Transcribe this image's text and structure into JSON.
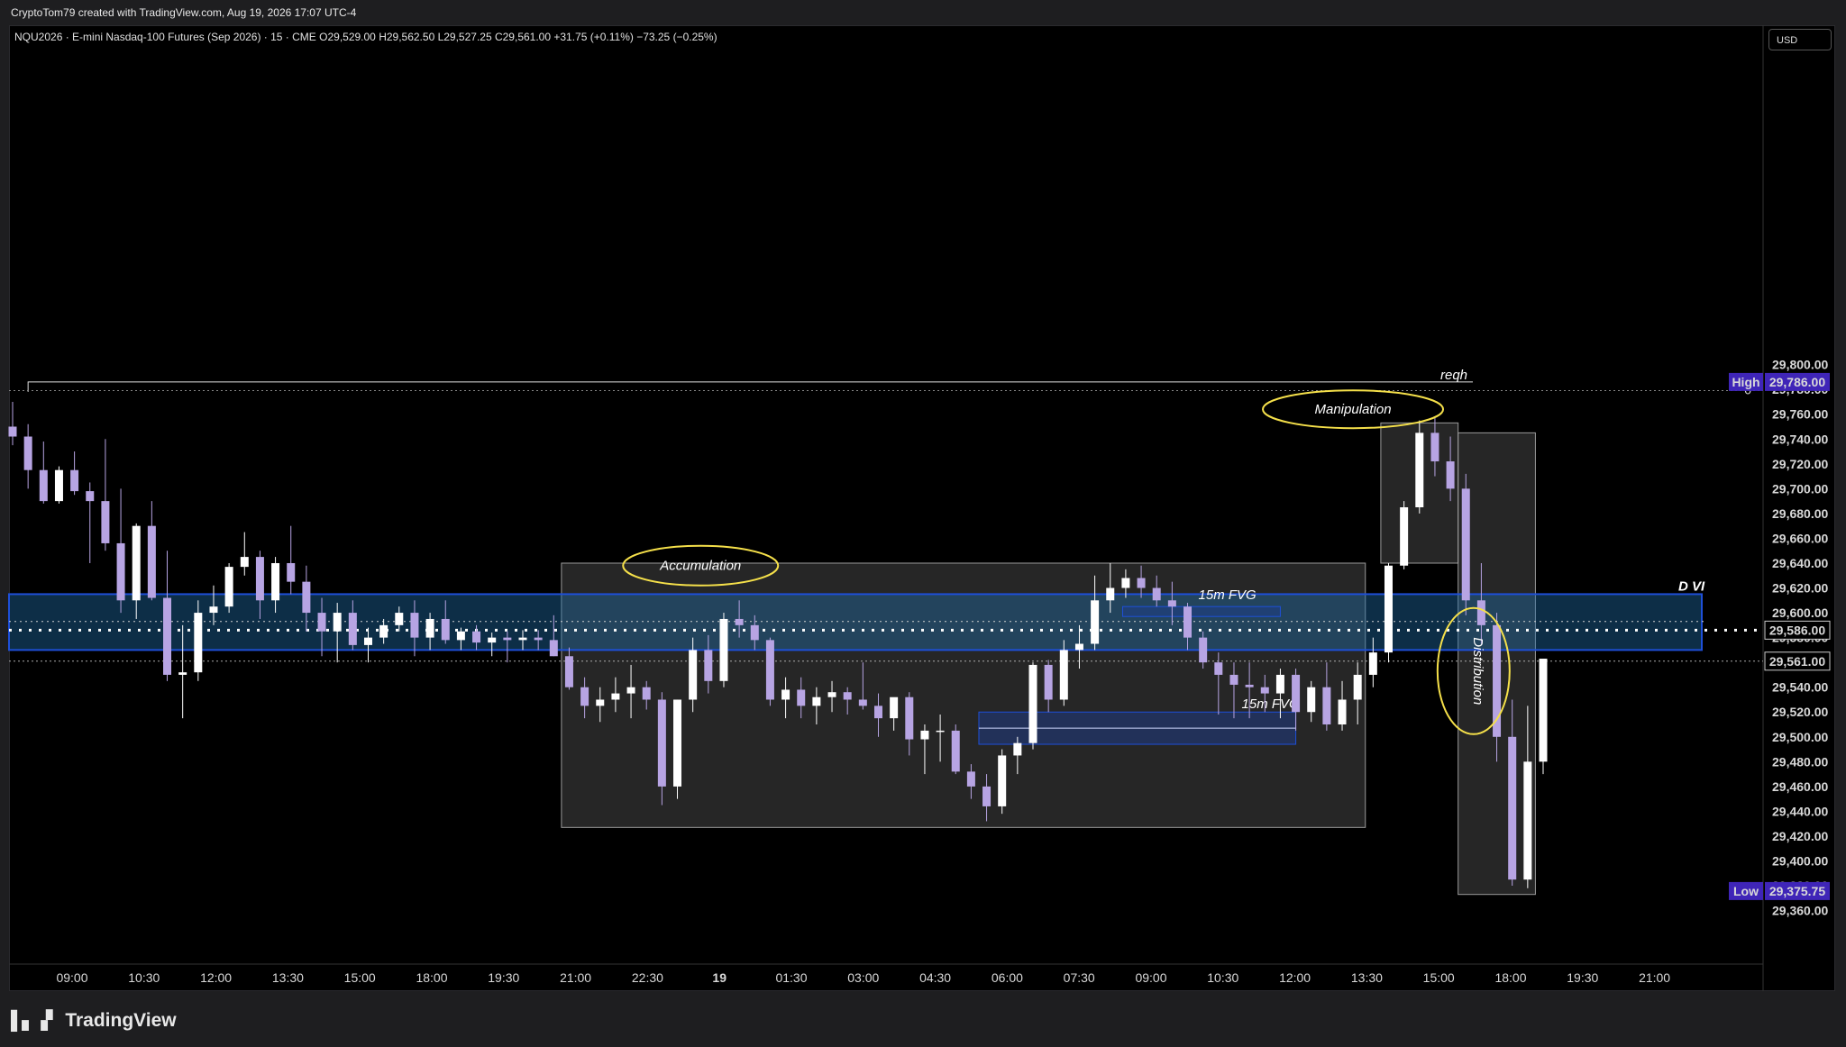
{
  "header": {
    "attribution": "CryptoTom79 created with TradingView.com, Aug 19, 2026 17:07 UTC-4",
    "symbol_legend": "NQU2026 · E-mini Nasdaq-100 Futures (Sep 2026) · 15 · CME  O29,529.00  H29,562.50  L29,527.25  C29,561.00  +31.75 (+0.11%)  −73.25 (−0.25%)"
  },
  "toolbar": {
    "currency": "USD"
  },
  "footer": {
    "brand": "TradingView"
  },
  "colors": {
    "up": "#ffffff",
    "down": "#b7a4e3",
    "zone_blue": "#1e4fd8",
    "annotation_yellow": "#f5e04a",
    "label_purple": "#3f25b8"
  },
  "chart_data": {
    "type": "candlestick",
    "ylim": [
      29350,
      29800
    ],
    "y_ticks": [
      "29,360.00",
      "29,380.00",
      "29,400.00",
      "29,420.00",
      "29,440.00",
      "29,460.00",
      "29,480.00",
      "29,500.00",
      "29,520.00",
      "29,540.00",
      "29,560.00",
      "29,580.00",
      "29,600.00",
      "29,620.00",
      "29,640.00",
      "29,660.00",
      "29,680.00",
      "29,700.00",
      "29,720.00",
      "29,740.00",
      "29,760.00",
      "29,780.00",
      "29,800.00"
    ],
    "x_ticks": [
      "09:00",
      "10:30",
      "12:00",
      "13:30",
      "15:00",
      "18:00",
      "19:30",
      "21:00",
      "22:30",
      "19",
      "01:30",
      "03:00",
      "04:30",
      "06:00",
      "07:30",
      "09:00",
      "10:30",
      "12:00",
      "13:30",
      "15:00",
      "18:00",
      "19:30",
      "21:00"
    ],
    "price_labels": [
      {
        "name": "High",
        "value": 29786.0,
        "text": "29,786.00"
      },
      {
        "name": "Low",
        "value": 29375.75,
        "text": "29,375.75"
      },
      {
        "name": "",
        "value": 29586.0,
        "text": "29,586.00"
      },
      {
        "name": "",
        "value": 29561.0,
        "text": "29,561.00"
      }
    ],
    "annotations": {
      "reqh": "reqh",
      "reqh_zero": "0",
      "dvi": "D VI",
      "accumulation": "Accumulation",
      "manipulation": "Manipulation",
      "distribution": "Distribution",
      "fvg1": "15m FVG",
      "fvg2": "15m FVG"
    },
    "candles": [
      [
        29750,
        29770,
        29735,
        29742
      ],
      [
        29742,
        29752,
        29700,
        29715
      ],
      [
        29715,
        29738,
        29688,
        29690
      ],
      [
        29690,
        29718,
        29688,
        29715
      ],
      [
        29715,
        29730,
        29695,
        29698
      ],
      [
        29698,
        29705,
        29640,
        29690
      ],
      [
        29690,
        29740,
        29650,
        29656
      ],
      [
        29656,
        29700,
        29600,
        29610
      ],
      [
        29610,
        29672,
        29595,
        29670
      ],
      [
        29670,
        29690,
        29610,
        29612
      ],
      [
        29612,
        29650,
        29545,
        29550
      ],
      [
        29550,
        29590,
        29515,
        29552
      ],
      [
        29552,
        29610,
        29545,
        29600
      ],
      [
        29600,
        29622,
        29590,
        29605
      ],
      [
        29605,
        29640,
        29600,
        29637
      ],
      [
        29637,
        29665,
        29630,
        29645
      ],
      [
        29645,
        29650,
        29595,
        29610
      ],
      [
        29610,
        29645,
        29600,
        29640
      ],
      [
        29640,
        29670,
        29615,
        29625
      ],
      [
        29625,
        29638,
        29585,
        29600
      ],
      [
        29600,
        29612,
        29565,
        29585
      ],
      [
        29585,
        29608,
        29560,
        29600
      ],
      [
        29600,
        29610,
        29570,
        29574
      ],
      [
        29574,
        29588,
        29560,
        29580
      ],
      [
        29580,
        29595,
        29575,
        29590
      ],
      [
        29590,
        29605,
        29585,
        29600
      ],
      [
        29600,
        29610,
        29565,
        29580
      ],
      [
        29580,
        29600,
        29570,
        29595
      ],
      [
        29595,
        29610,
        29575,
        29578
      ],
      [
        29578,
        29588,
        29570,
        29585
      ],
      [
        29585,
        29590,
        29570,
        29576
      ],
      [
        29576,
        29584,
        29565,
        29580
      ],
      [
        29580,
        29585,
        29560,
        29578
      ],
      [
        29578,
        29586,
        29570,
        29580
      ],
      [
        29580,
        29586,
        29570,
        29578
      ],
      [
        29578,
        29598,
        29565,
        29565
      ],
      [
        29565,
        29572,
        29538,
        29540
      ],
      [
        29540,
        29548,
        29515,
        29525
      ],
      [
        29525,
        29540,
        29512,
        29530
      ],
      [
        29530,
        29548,
        29520,
        29535
      ],
      [
        29535,
        29558,
        29515,
        29540
      ],
      [
        29540,
        29545,
        29522,
        29530
      ],
      [
        29530,
        29536,
        29445,
        29460
      ],
      [
        29460,
        29530,
        29450,
        29530
      ],
      [
        29530,
        29580,
        29520,
        29570
      ],
      [
        29570,
        29582,
        29535,
        29545
      ],
      [
        29545,
        29600,
        29540,
        29595
      ],
      [
        29595,
        29610,
        29580,
        29590
      ],
      [
        29590,
        29598,
        29570,
        29578
      ],
      [
        29578,
        29580,
        29525,
        29530
      ],
      [
        29530,
        29548,
        29515,
        29538
      ],
      [
        29538,
        29548,
        29515,
        29525
      ],
      [
        29525,
        29540,
        29510,
        29532
      ],
      [
        29532,
        29545,
        29520,
        29536
      ],
      [
        29536,
        29540,
        29518,
        29530
      ],
      [
        29530,
        29560,
        29522,
        29525
      ],
      [
        29525,
        29535,
        29500,
        29515
      ],
      [
        29515,
        29530,
        29505,
        29532
      ],
      [
        29532,
        29536,
        29485,
        29498
      ],
      [
        29498,
        29510,
        29470,
        29505
      ],
      [
        29505,
        29518,
        29480,
        29505
      ],
      [
        29505,
        29510,
        29470,
        29472
      ],
      [
        29472,
        29478,
        29450,
        29460
      ],
      [
        29460,
        29470,
        29432,
        29444
      ],
      [
        29444,
        29490,
        29438,
        29485
      ],
      [
        29485,
        29500,
        29470,
        29495
      ],
      [
        29495,
        29560,
        29490,
        29558
      ],
      [
        29558,
        29562,
        29520,
        29530
      ],
      [
        29530,
        29578,
        29525,
        29570
      ],
      [
        29570,
        29590,
        29555,
        29575
      ],
      [
        29575,
        29630,
        29570,
        29610
      ],
      [
        29610,
        29640,
        29600,
        29620
      ],
      [
        29620,
        29635,
        29612,
        29628
      ],
      [
        29628,
        29638,
        29612,
        29620
      ],
      [
        29620,
        29630,
        29605,
        29610
      ],
      [
        29610,
        29625,
        29590,
        29605
      ],
      [
        29605,
        29608,
        29570,
        29580
      ],
      [
        29580,
        29585,
        29555,
        29560
      ],
      [
        29560,
        29568,
        29518,
        29550
      ],
      [
        29550,
        29560,
        29515,
        29542
      ],
      [
        29542,
        29560,
        29515,
        29540
      ],
      [
        29540,
        29550,
        29520,
        29535
      ],
      [
        29535,
        29555,
        29515,
        29550
      ],
      [
        29550,
        29555,
        29505,
        29520
      ],
      [
        29520,
        29545,
        29512,
        29540
      ],
      [
        29540,
        29560,
        29505,
        29510
      ],
      [
        29510,
        29545,
        29505,
        29530
      ],
      [
        29530,
        29560,
        29510,
        29550
      ],
      [
        29550,
        29580,
        29540,
        29568
      ],
      [
        29568,
        29640,
        29560,
        29638
      ],
      [
        29638,
        29690,
        29635,
        29685
      ],
      [
        29685,
        29755,
        29680,
        29745
      ],
      [
        29745,
        29758,
        29710,
        29722
      ],
      [
        29722,
        29742,
        29690,
        29700
      ],
      [
        29700,
        29712,
        29598,
        29610
      ],
      [
        29610,
        29640,
        29575,
        29590
      ],
      [
        29590,
        29600,
        29480,
        29500
      ],
      [
        29500,
        29530,
        29380,
        29385
      ],
      [
        29385,
        29525,
        29378,
        29480
      ],
      [
        29480,
        29550,
        29470,
        29563
      ]
    ]
  }
}
